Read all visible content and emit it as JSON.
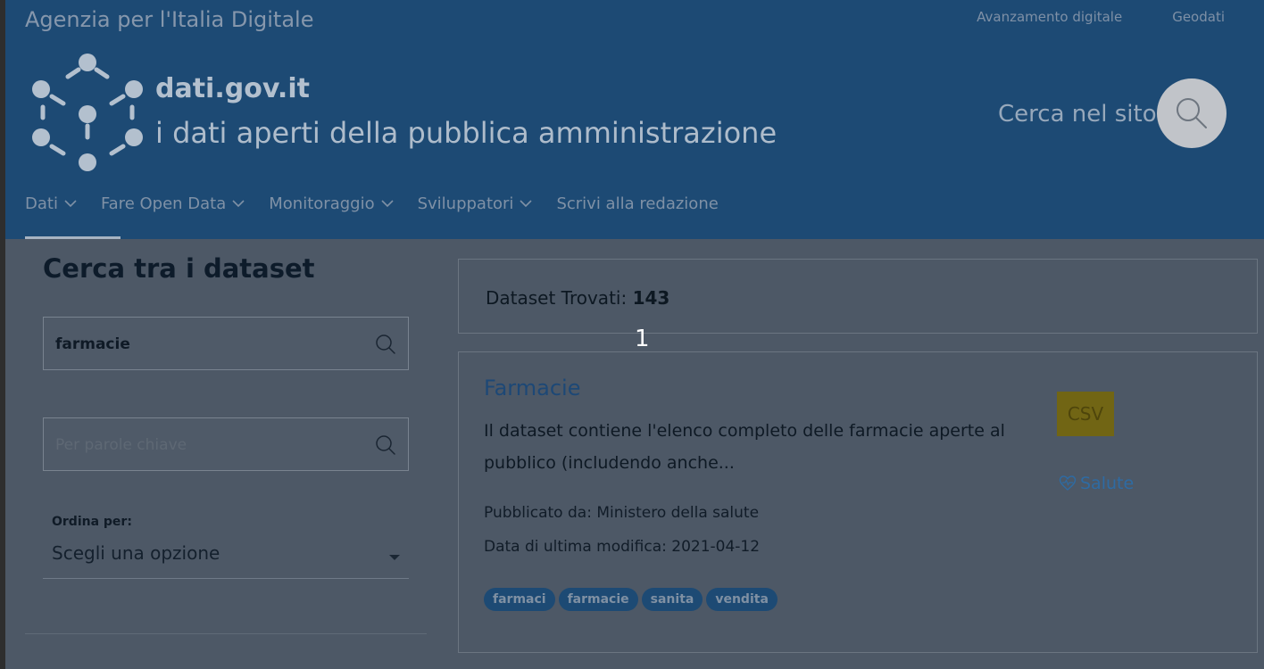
{
  "header": {
    "agency": "Agenzia per l'Italia Digitale",
    "top_links": [
      "Avanzamento digitale",
      "Geodati"
    ],
    "brand_title": "dati.gov.it",
    "brand_subtitle": "i dati aperti della pubblica amministrazione",
    "search_label": "Cerca nel sito",
    "nav": [
      {
        "label": "Dati",
        "dropdown": true
      },
      {
        "label": "Fare Open Data",
        "dropdown": true
      },
      {
        "label": "Monitoraggio",
        "dropdown": true
      },
      {
        "label": "Sviluppatori",
        "dropdown": true
      },
      {
        "label": "Scrivi alla redazione",
        "dropdown": false
      }
    ]
  },
  "sidebar": {
    "title": "Cerca tra i dataset",
    "search_value": "farmacie",
    "keyword_placeholder": "Per parole chiave",
    "order_label": "Ordina per:",
    "order_value": "Scegli una opzione"
  },
  "results": {
    "count_label": "Dataset Trovati:",
    "count": "143",
    "page_number": "1",
    "items": [
      {
        "title": "Farmacie",
        "description": "Il dataset contiene l'elenco completo delle farmacie aperte al pubblico (includendo anche...",
        "publisher": "Pubblicato da: Ministero della salute",
        "modified": "Data di ultima modifica:  2021-04-12",
        "format": "CSV",
        "theme": "Salute",
        "tags": [
          "farmaci",
          "farmacie",
          "sanita",
          "vendita"
        ]
      }
    ]
  },
  "colors": {
    "header_bg": "#1d4a74",
    "overlay_bg": "#4d5866",
    "tag_bg": "#1d4a74",
    "csv_badge": "#716514",
    "link": "#1d4876"
  },
  "icons": [
    "search-icon",
    "chevron-down-icon",
    "heart-pulse-icon",
    "dati-logo-icon"
  ]
}
